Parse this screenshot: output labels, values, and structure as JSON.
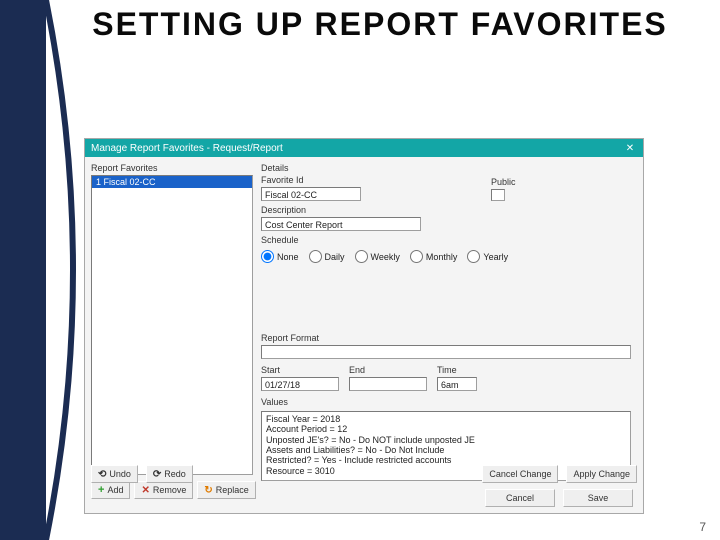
{
  "slide": {
    "title": "SETTING UP REPORT FAVORITES",
    "page_number": "7"
  },
  "dialog": {
    "title": "Manage Report Favorites - Request/Report",
    "favorites_label": "Report Favorites",
    "favorites": [
      {
        "label": "1 Fiscal 02-CC"
      }
    ],
    "add_label": "Add",
    "remove_label": "Remove",
    "replace_label": "Replace",
    "undo_label": "Undo",
    "redo_label": "Redo",
    "cancel_change_label": "Cancel Change",
    "apply_change_label": "Apply Change",
    "cancel_label": "Cancel",
    "save_label": "Save"
  },
  "details": {
    "heading": "Details",
    "favorite_id_label": "Favorite Id",
    "favorite_id": "Fiscal 02-CC",
    "public_label": "Public",
    "description_label": "Description",
    "description": "Cost Center Report",
    "schedule_label": "Schedule",
    "schedule_options": [
      "None",
      "Daily",
      "Weekly",
      "Monthly",
      "Yearly"
    ],
    "schedule_selected": "None",
    "report_format_label": "Report Format",
    "report_format": "",
    "start_label": "Start",
    "start": "01/27/18",
    "end_label": "End",
    "end": "",
    "time_label": "Time",
    "time": "6am",
    "values_label": "Values",
    "values_lines": [
      "Fiscal Year = 2018",
      "Account Period = 12",
      "Unposted JE's? = No - Do NOT include unposted JE",
      "Assets and Liabilities? = No - Do Not Include",
      "Restricted? = Yes - Include restricted accounts",
      "Resource = 3010"
    ]
  }
}
